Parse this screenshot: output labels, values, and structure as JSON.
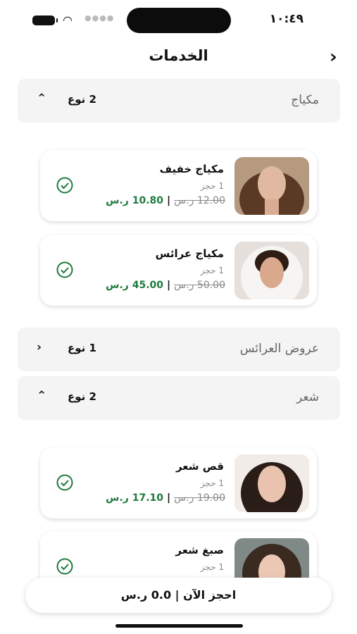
{
  "status": {
    "time": "١٠:٤٩"
  },
  "header": {
    "title": "الخدمات",
    "back_icon": "chevron-right-icon"
  },
  "sections": [
    {
      "name": "مكياج",
      "count": "2 نوع",
      "expanded": true,
      "items": [
        {
          "name": "مكياج خفيف",
          "bookings": "1 حجز",
          "old_price": "12.00 ر.س",
          "new_price": "10.80 ر.س"
        },
        {
          "name": "مكياج عرائس",
          "bookings": "1 حجز",
          "old_price": "50.00 ر.س",
          "new_price": "45.00 ر.س"
        }
      ]
    },
    {
      "name": "عروض العرائس",
      "count": "1 نوع",
      "expanded": false
    },
    {
      "name": "شعر",
      "count": "2 نوع",
      "expanded": true,
      "items": [
        {
          "name": "قص شعر",
          "bookings": "1 حجز",
          "old_price": "19.00 ر.س",
          "new_price": "17.10 ر.س"
        },
        {
          "name": "صبغ شعر",
          "bookings": "1 حجز"
        }
      ]
    }
  ],
  "book_button": {
    "label": "احجز الآن | 0.0 ر.س"
  },
  "colors": {
    "accent_green": "#1f7a3e",
    "section_bg": "#f4f4f5"
  }
}
